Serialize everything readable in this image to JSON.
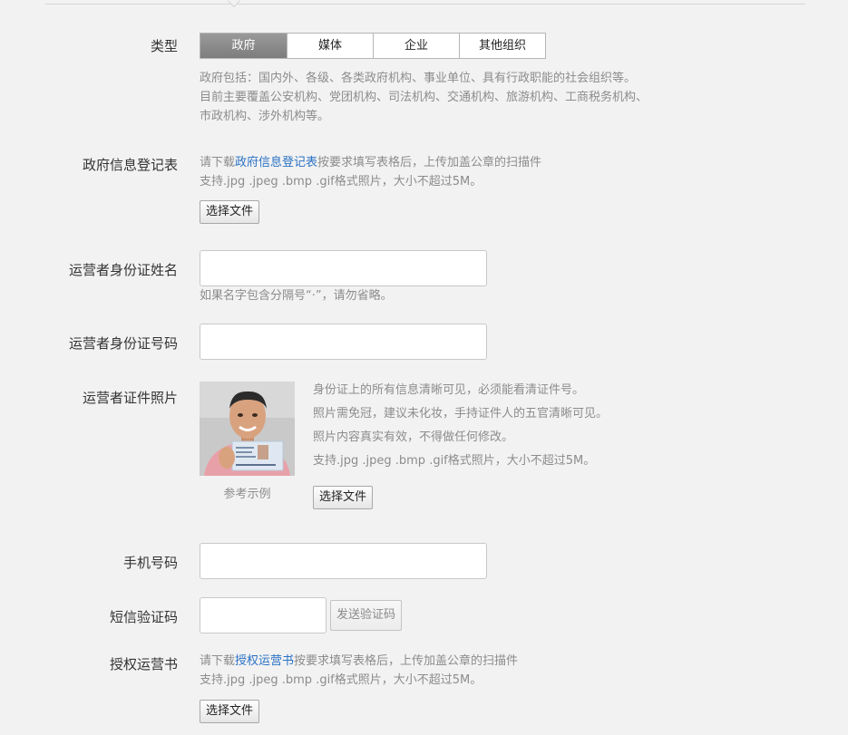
{
  "type_section": {
    "label": "类型",
    "tabs": [
      "政府",
      "媒体",
      "企业",
      "其他组织"
    ],
    "selected": "政府",
    "desc_lines": [
      "政府包括：国内外、各级、各类政府机构、事业单位、具有行政职能的社会组织等。",
      "目前主要覆盖公安机构、党团机构、司法机构、交通机构、旅游机构、工商税务机构、",
      "市政机构、涉外机构等。"
    ]
  },
  "gov_form": {
    "label": "政府信息登记表",
    "hint_prefix": "请下载",
    "hint_link": "政府信息登记表",
    "hint_suffix": "按要求填写表格后，上传加盖公章的扫描件",
    "format_hint": "支持.jpg .jpeg .bmp .gif格式照片，大小不超过5M。",
    "button": "选择文件"
  },
  "id_name": {
    "label": "运营者身份证姓名",
    "value": "",
    "hint": "如果名字包含分隔号“·”，请勿省略。"
  },
  "id_number": {
    "label": "运营者身份证号码",
    "value": ""
  },
  "id_photo": {
    "label": "运营者证件照片",
    "caption": "参考示例",
    "hints": [
      "身份证上的所有信息清晰可见，必须能看清证件号。",
      "照片需免冠，建议未化妆，手持证件人的五官清晰可见。",
      "照片内容真实有效，不得做任何修改。",
      "支持.jpg .jpeg .bmp .gif格式照片，大小不超过5M。"
    ],
    "button": "选择文件",
    "colors": {
      "shirt": "#e8a0a8",
      "card": "#dfe8f2",
      "skin": "#d9a27e"
    }
  },
  "phone": {
    "label": "手机号码",
    "value": ""
  },
  "sms": {
    "label": "短信验证码",
    "value": "",
    "button": "发送验证码"
  },
  "auth": {
    "label": "授权运营书",
    "hint_prefix": "请下载",
    "hint_link": "授权运营书",
    "hint_suffix": "按要求填写表格后，上传加盖公章的扫描件",
    "format_hint": "支持.jpg .jpeg .bmp .gif格式照片，大小不超过5M。",
    "button": "选择文件"
  },
  "theme": {
    "link_color": "#2a72c4",
    "selected_tab": "#808080",
    "hint_color": "#8c8c8c"
  }
}
